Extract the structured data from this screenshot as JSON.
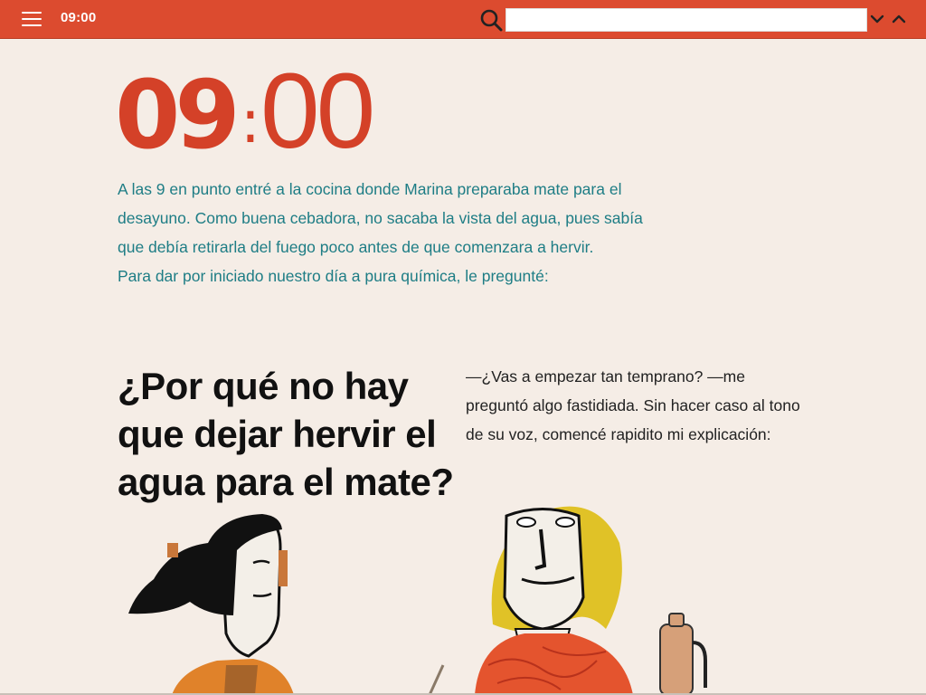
{
  "header": {
    "title": "09:00",
    "search": {
      "value": "",
      "placeholder": ""
    },
    "icons": [
      "menu-icon",
      "search-icon",
      "chevron-down-icon",
      "chevron-up-icon"
    ]
  },
  "hero": {
    "hour": "09",
    "colon": ":",
    "minutes": "00"
  },
  "intro": {
    "paragraph1": "A las 9 en punto entré a la cocina donde Marina preparaba mate para el desayuno. Como buena cebadora, no sacaba la vista del agua, pues sabía que debía retirarla del fuego poco antes de que comenzara a hervir.",
    "paragraph2": "Para dar por iniciado nuestro día a pura química, le pregunté:"
  },
  "question": "¿Por qué no hay que dejar hervir el agua para el mate?",
  "dialog": "—¿Vas a empezar tan temprano? —me preguntó algo fastidiada. Sin hacer caso al tono de su voz, comencé rapidito mi explicación:",
  "colors": {
    "accent": "#dc4b2f",
    "title_red": "#d44128",
    "intro_teal": "#1e7d85",
    "background": "#f5ede6"
  }
}
